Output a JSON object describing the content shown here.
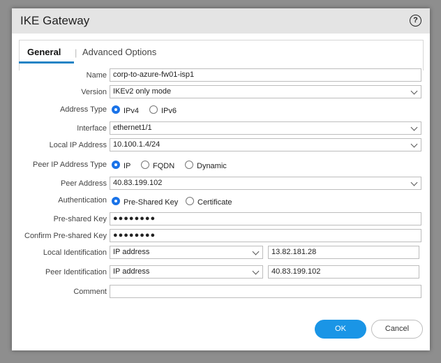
{
  "dialog": {
    "title": "IKE Gateway",
    "help_glyph": "?"
  },
  "tabs": [
    {
      "label": "General",
      "active": true
    },
    {
      "label": "Advanced Options",
      "active": false
    }
  ],
  "tab_separator": "|",
  "form": {
    "name": {
      "label": "Name",
      "value": "corp-to-azure-fw01-isp1"
    },
    "version": {
      "label": "Version",
      "value": "IKEv2 only mode"
    },
    "address_type": {
      "label": "Address Type",
      "options": [
        "IPv4",
        "IPv6"
      ],
      "selected": "IPv4"
    },
    "interface": {
      "label": "Interface",
      "value": "ethernet1/1"
    },
    "local_ip": {
      "label": "Local IP Address",
      "value": "10.100.1.4/24"
    },
    "peer_ip_type": {
      "label": "Peer IP Address Type",
      "options": [
        "IP",
        "FQDN",
        "Dynamic"
      ],
      "selected": "IP"
    },
    "peer_address": {
      "label": "Peer Address",
      "value": "40.83.199.102"
    },
    "authentication": {
      "label": "Authentication",
      "options": [
        "Pre-Shared Key",
        "Certificate"
      ],
      "selected": "Pre-Shared Key"
    },
    "psk": {
      "label": "Pre-shared Key",
      "value": "●●●●●●●●"
    },
    "confirm_psk": {
      "label": "Confirm Pre-shared Key",
      "value": "●●●●●●●●"
    },
    "local_id": {
      "label": "Local Identification",
      "type": "IP address",
      "value": "13.82.181.28"
    },
    "peer_id": {
      "label": "Peer Identification",
      "type": "IP address",
      "value": "40.83.199.102"
    },
    "comment": {
      "label": "Comment",
      "value": ""
    }
  },
  "buttons": {
    "ok": "OK",
    "cancel": "Cancel"
  },
  "colors": {
    "accent": "#1a95e6",
    "tab_underline": "#2584c5",
    "radio_selected": "#1a73e8"
  }
}
